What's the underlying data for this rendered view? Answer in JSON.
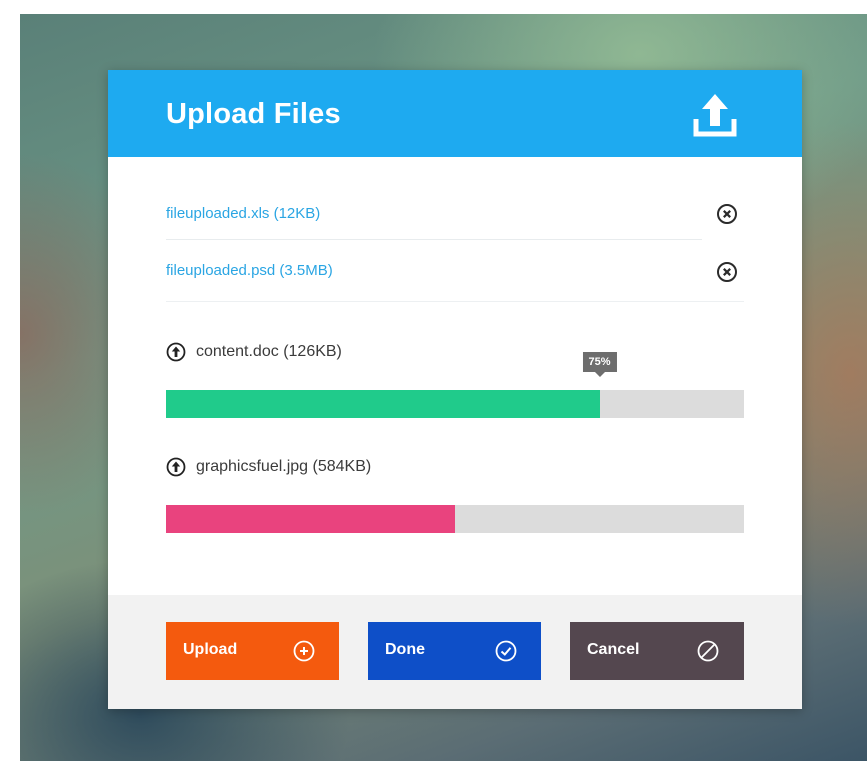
{
  "header": {
    "title": "Upload Files",
    "icon": "upload-icon",
    "color": "#1eaaf0"
  },
  "uploaded_files": [
    {
      "name": "fileuploaded.xls (12KB)",
      "remove_icon": "close-circle-icon"
    },
    {
      "name": "fileuploaded.psd (3.5MB)",
      "remove_icon": "close-circle-icon"
    }
  ],
  "uploads_in_progress": [
    {
      "name": "content.doc",
      "size": "(126KB)",
      "progress_percent": 75,
      "progress_label": "75%",
      "bar_color": "#20cb8b",
      "icon": "arrow-up-circle-icon"
    },
    {
      "name": "graphicsfuel.jpg",
      "size": "(584KB)",
      "progress_percent": 50,
      "bar_color": "#e9437e",
      "icon": "arrow-up-circle-icon"
    }
  ],
  "footer": {
    "buttons": [
      {
        "label": "Upload",
        "icon": "plus-circle-icon",
        "color": "#f45a0e"
      },
      {
        "label": "Done",
        "icon": "check-circle-icon",
        "color": "#0e4fc8"
      },
      {
        "label": "Cancel",
        "icon": "block-icon",
        "color": "#54474f"
      }
    ]
  }
}
